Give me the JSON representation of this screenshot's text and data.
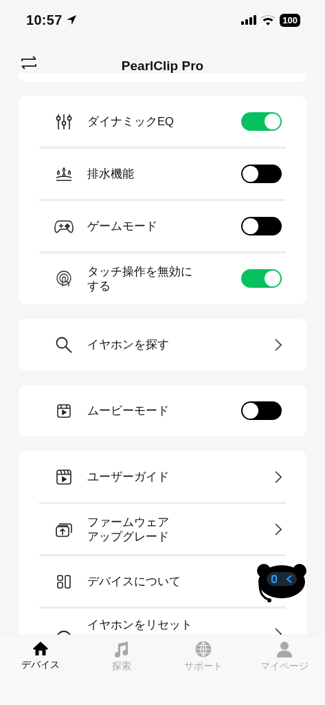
{
  "status_bar": {
    "time": "10:57",
    "battery": "100"
  },
  "header": {
    "title": "PearlClip Pro"
  },
  "sections": [
    {
      "items": [
        {
          "kind": "toggle",
          "label": "ダイナミックEQ",
          "on": true
        },
        {
          "kind": "toggle",
          "label": "排水機能",
          "on": false
        },
        {
          "kind": "toggle",
          "label": "ゲームモード",
          "on": false
        },
        {
          "kind": "toggle",
          "label": "タッチ操作を無効にする",
          "on": true
        }
      ]
    },
    {
      "items": [
        {
          "kind": "link",
          "label": "イヤホンを探す"
        }
      ]
    },
    {
      "items": [
        {
          "kind": "toggle",
          "label": "ムービーモード",
          "on": false
        }
      ]
    },
    {
      "items": [
        {
          "kind": "link",
          "label": "ユーザーガイド"
        },
        {
          "kind": "link",
          "label": "ファームウェアアップグレード"
        },
        {
          "kind": "link",
          "label": "デバイスについて"
        },
        {
          "kind": "link",
          "label": "イヤホンをリセット"
        }
      ]
    }
  ],
  "tabs": [
    {
      "label": "デバイス",
      "selected": true
    },
    {
      "label": "探索",
      "selected": false
    },
    {
      "label": "サポート",
      "selected": false
    },
    {
      "label": "マイページ",
      "selected": false
    }
  ]
}
